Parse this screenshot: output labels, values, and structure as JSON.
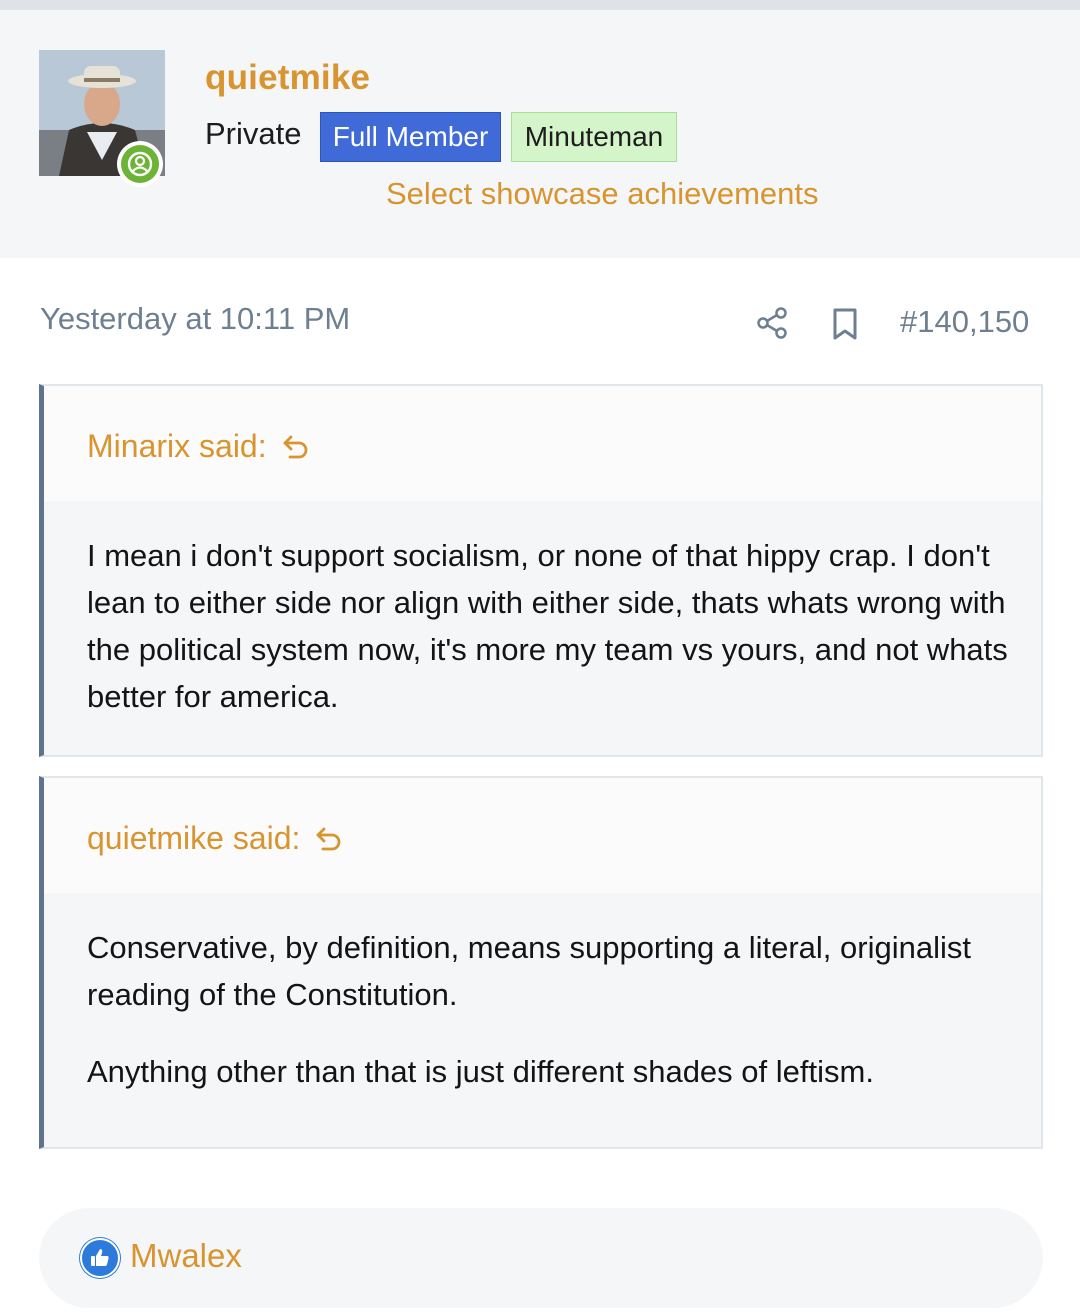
{
  "header": {
    "username": "quietmike",
    "user_title": "Private",
    "banners": [
      "Full Member",
      "Minuteman"
    ],
    "showcase_link": "Select showcase achievements"
  },
  "post": {
    "timestamp": "Yesterday at 10:11 PM",
    "post_number": "#140,150",
    "share_icon": "share-icon",
    "bookmark_icon": "bookmark-icon"
  },
  "quotes": [
    {
      "author": "Minarix said:",
      "paragraphs": [
        "I mean i don't support socialism, or none of that hippy crap. I don't lean to either side nor align with either side, thats whats wrong with the political system now, it's more my team vs yours, and not whats better for america."
      ]
    },
    {
      "author": "quietmike said:",
      "paragraphs": [
        "Conservative, by definition, means supporting a literal, originalist reading of the Constitution.",
        "Anything other than that is just different shades of leftism."
      ]
    }
  ],
  "reactions": {
    "icon": "thumbs-up-icon",
    "users": "Mwalex"
  },
  "colors": {
    "accent": "#d8942e",
    "full_member": "#3f6ad8",
    "minuteman": "#d4f5c9",
    "quote_bar": "#5f7391",
    "online": "#6cb336",
    "like": "#2c7ad9"
  }
}
